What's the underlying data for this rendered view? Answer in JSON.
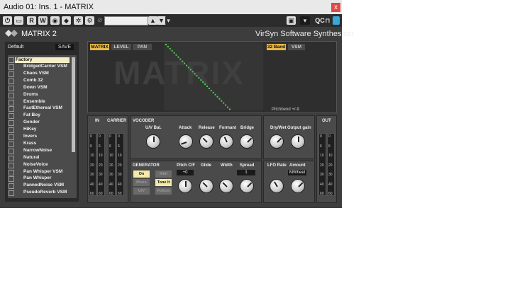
{
  "window": {
    "title": "Audio 01: Ins. 1 - MATRIX",
    "close": "x"
  },
  "toolbar": {
    "r": "R",
    "w": "W",
    "qc": "QC"
  },
  "header": {
    "product": "MATRIX 2",
    "vendor": "VirSyn Software Synthesizer"
  },
  "presets": {
    "bank": "Default",
    "save": "SAVE",
    "folder": "Factory",
    "items": [
      "BridgedCarrier VSM",
      "Chaos VSM",
      "Comb 32",
      "Down VSM",
      "Drums",
      "Ensemble",
      "FastEthereal VSM",
      "Fat Boy",
      "Gender",
      "HiKey",
      "Invers",
      "Krass",
      "NarrowNoise",
      "Natural",
      "NoiseVoice",
      "Pan Whisper VSM",
      "Pan Whisper",
      "PannedNoise VSM",
      "PseudoReverb VSM"
    ]
  },
  "matrix": {
    "tabs": [
      "MATRIX",
      "LEVEL",
      "PAN"
    ],
    "band": "32 Band",
    "vsm": "VSM",
    "watermark": "MATRIX",
    "pitchbend": "Pitchbend +/-9"
  },
  "sections": {
    "in": "IN",
    "carrier": "CARRIER",
    "out": "OUT",
    "vocoder": "VOCODER",
    "generator": "GENERATOR"
  },
  "vocoder": {
    "uv_bal": "U/V Bal.",
    "attack": "Attack",
    "release": "Release",
    "formant": "Formant",
    "bridge": "Bridge"
  },
  "mix": {
    "drywet": "Dry/Wet",
    "output": "Output gain"
  },
  "generator": {
    "on": "On",
    "midi": "Midi",
    "mono": "Mono",
    "toneit": "Tone It",
    "uv": "U/V",
    "follow": "Follow",
    "pitch": "Pitch C/F",
    "pitch_val": "+0",
    "glide": "Glide",
    "width": "Width",
    "spread": "Spread",
    "spread_val": "1"
  },
  "lfo": {
    "rate": "LFO Rate",
    "amount": "Amount",
    "mwheel": "MWheel"
  },
  "meter_ticks": [
    "0",
    "6",
    "10",
    "20",
    "30",
    "40",
    "60"
  ]
}
